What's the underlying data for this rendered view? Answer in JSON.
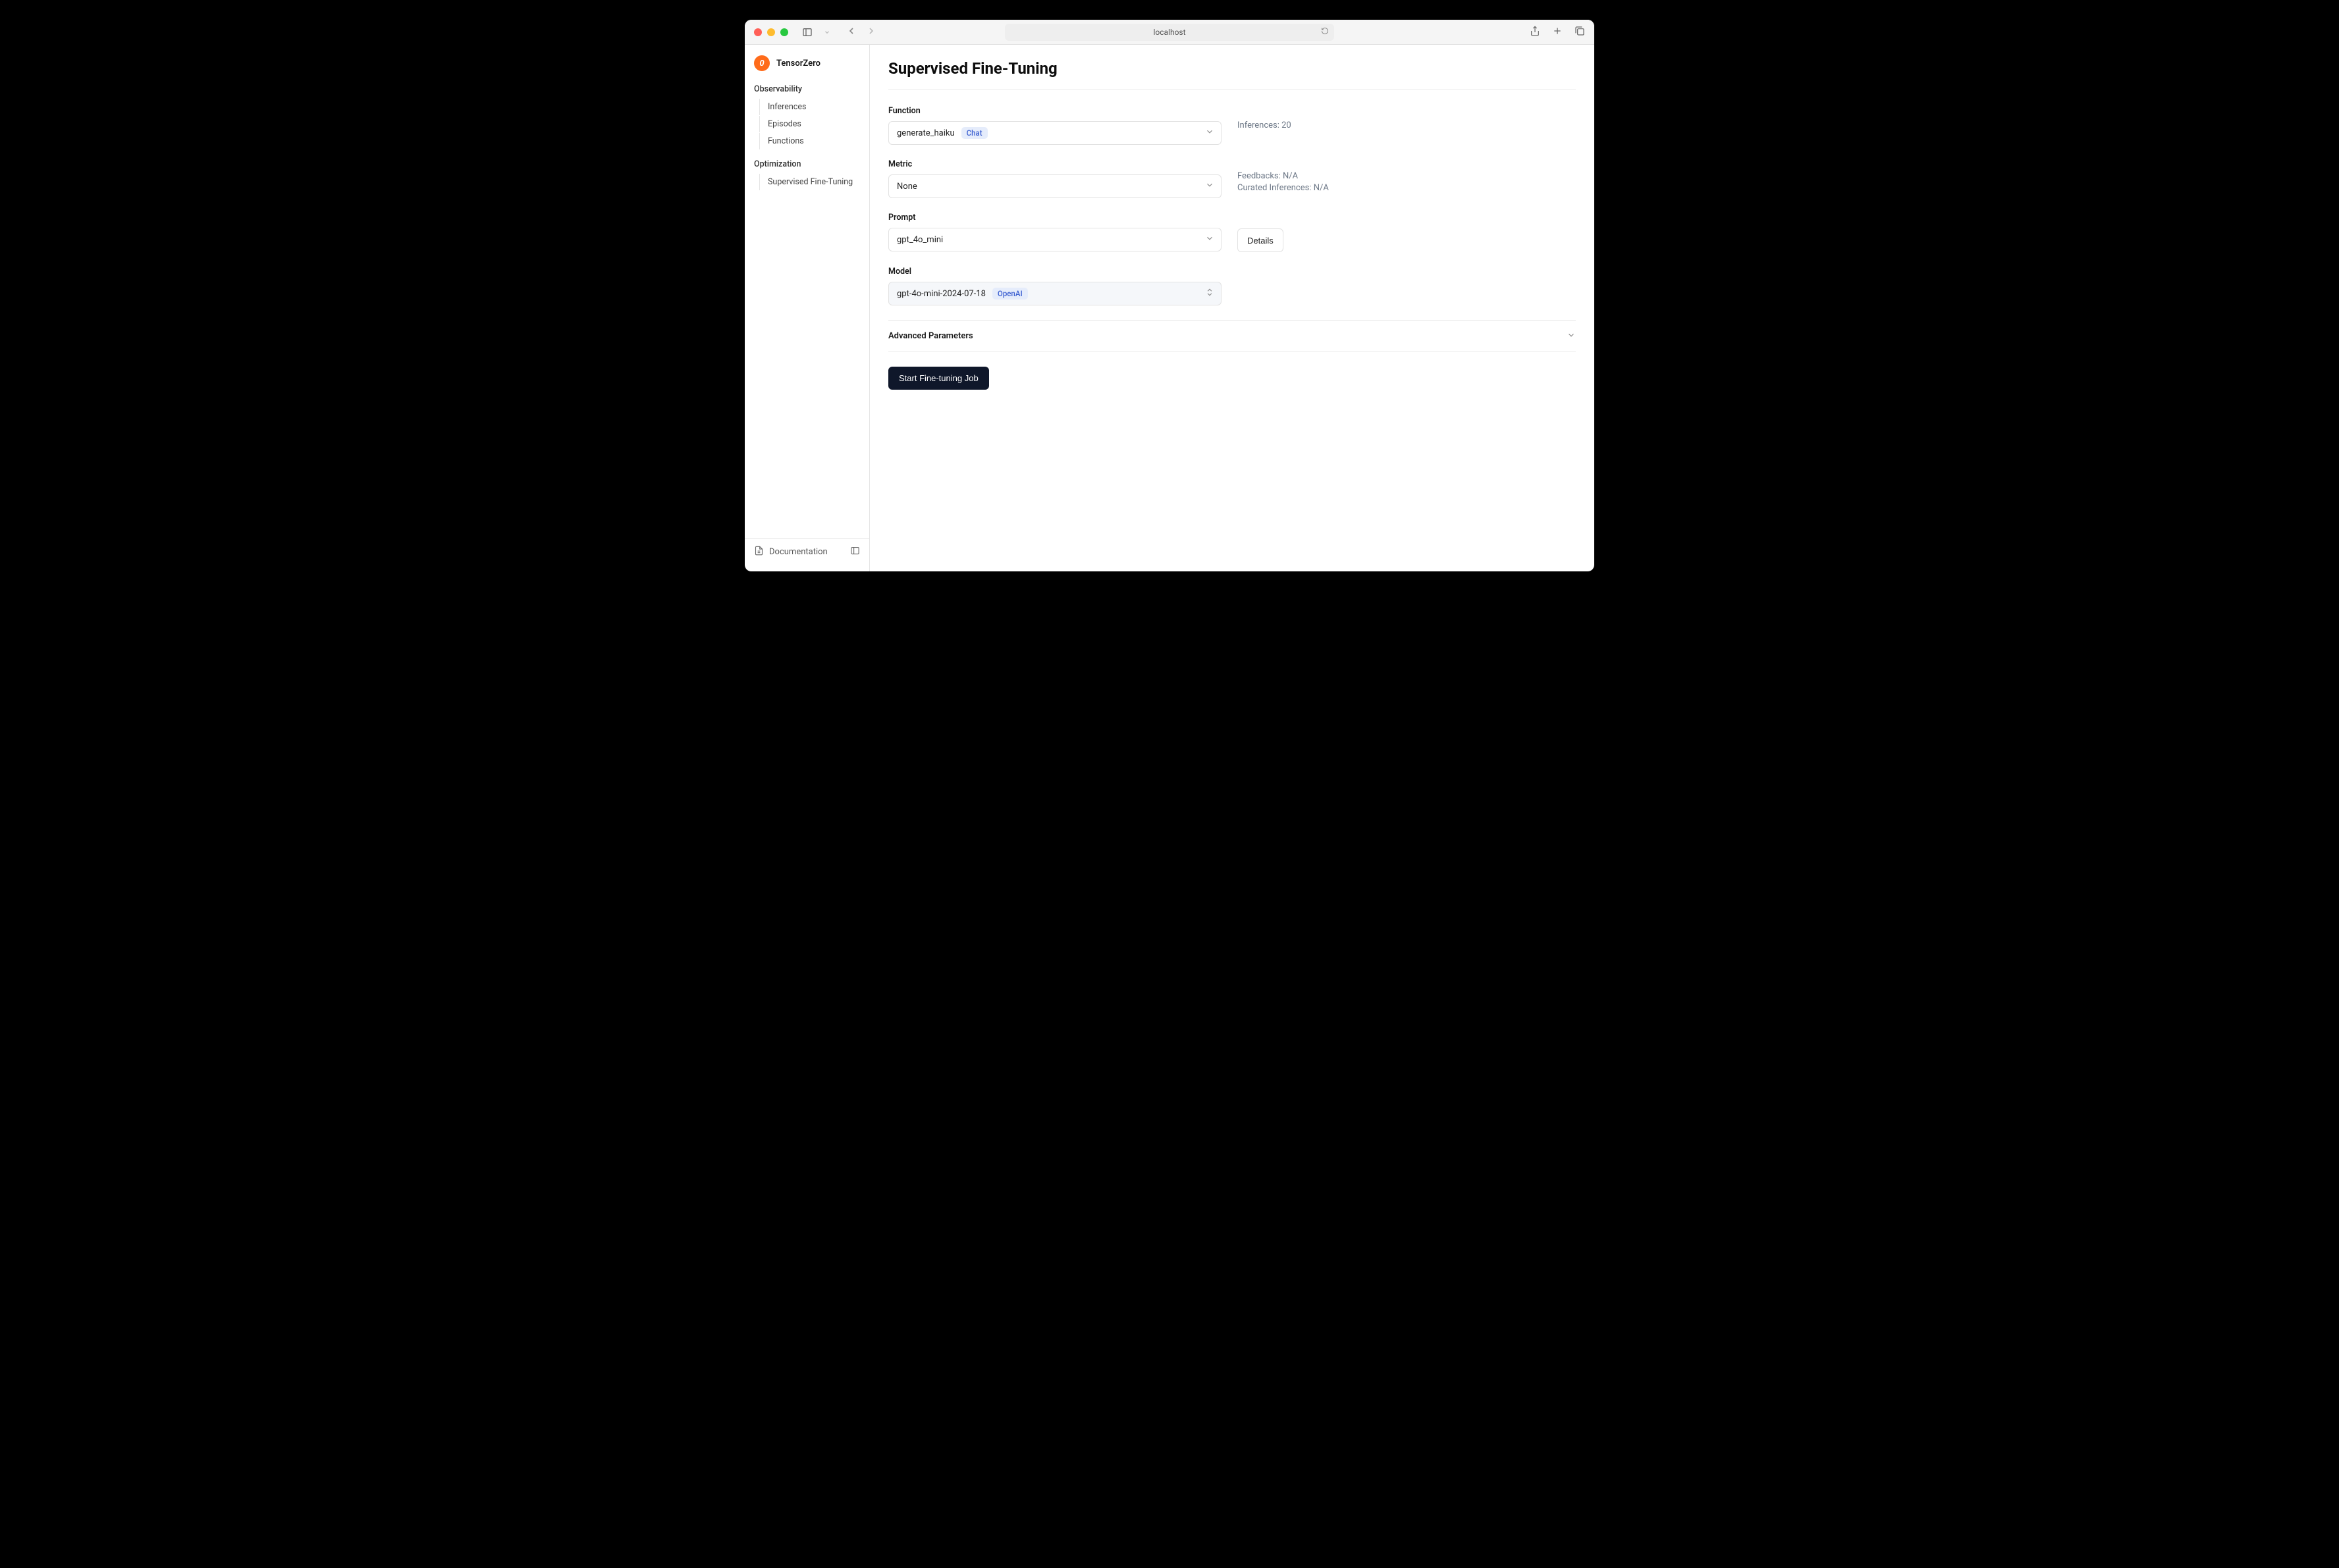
{
  "browser": {
    "url": "localhost"
  },
  "brand": {
    "name": "TensorZero",
    "logo_char": "0"
  },
  "sidebar": {
    "sections": [
      {
        "title": "Observability",
        "items": [
          {
            "label": "Inferences"
          },
          {
            "label": "Episodes"
          },
          {
            "label": "Functions"
          }
        ]
      },
      {
        "title": "Optimization",
        "items": [
          {
            "label": "Supervised Fine-Tuning"
          }
        ]
      }
    ],
    "footer": {
      "documentation": "Documentation"
    }
  },
  "page": {
    "title": "Supervised Fine-Tuning",
    "form": {
      "function": {
        "label": "Function",
        "value": "generate_haiku",
        "badge": "Chat",
        "info": {
          "inferences_label": "Inferences:",
          "inferences_value": "20"
        }
      },
      "metric": {
        "label": "Metric",
        "value": "None",
        "info": {
          "feedbacks_label": "Feedbacks:",
          "feedbacks_value": "N/A",
          "curated_label": "Curated Inferences:",
          "curated_value": "N/A"
        }
      },
      "prompt": {
        "label": "Prompt",
        "value": "gpt_4o_mini",
        "details_button": "Details"
      },
      "model": {
        "label": "Model",
        "value": "gpt-4o-mini-2024-07-18",
        "badge": "OpenAI"
      },
      "advanced": {
        "title": "Advanced Parameters"
      },
      "submit": "Start Fine-tuning Job"
    }
  }
}
